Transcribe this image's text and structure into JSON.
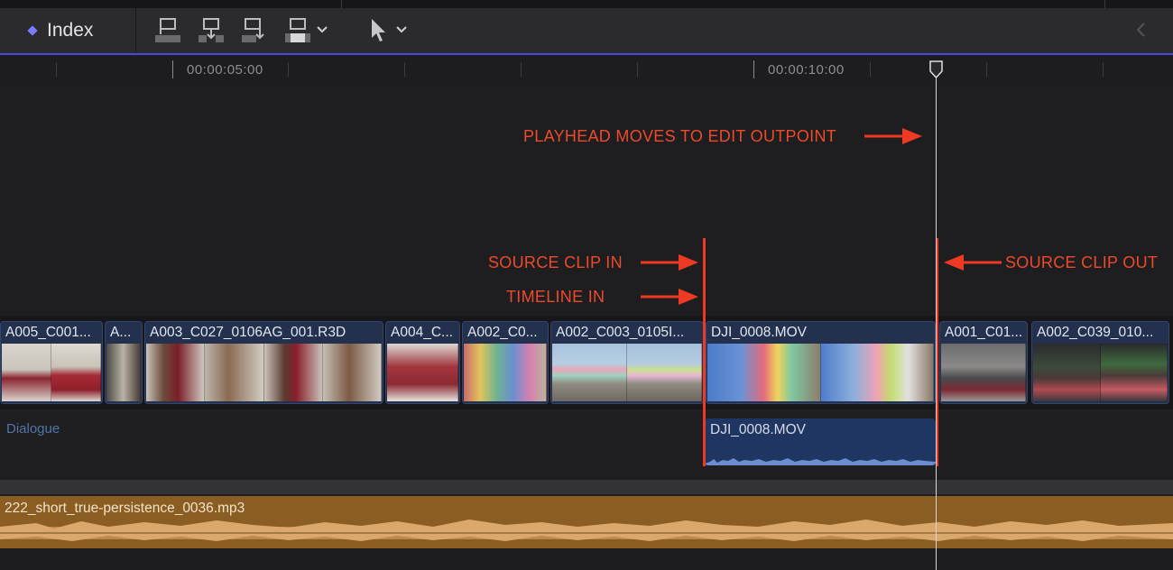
{
  "toolbar": {
    "index_label": "Index",
    "tools": [
      {
        "icon": "connect-clip-icon"
      },
      {
        "icon": "insert-clip-icon"
      },
      {
        "icon": "append-clip-icon"
      },
      {
        "icon": "overwrite-clip-icon"
      },
      {
        "icon": "select-tool-icon"
      }
    ]
  },
  "ruler": {
    "timecodes": [
      "00:00:05:00",
      "00:00:10:00"
    ]
  },
  "colors": {
    "annotation_red": "#ee3a22",
    "video_clip": "#23314f",
    "music_clip": "#8a5d23",
    "index_accent": "#7a7cff"
  },
  "timeline": {
    "video_clips": [
      {
        "name": "A005_C001..."
      },
      {
        "name": "A..."
      },
      {
        "name": "A003_C027_0106AG_001.R3D"
      },
      {
        "name": "A004_C..."
      },
      {
        "name": "A002_C0..."
      },
      {
        "name": "A002_C003_0105I..."
      },
      {
        "name": "DJI_0008.MOV"
      },
      {
        "name": "A001_C01..."
      },
      {
        "name": "A002_C039_010..."
      }
    ],
    "dialogue_role": "Dialogue",
    "audio_clip": "DJI_0008.MOV",
    "music_clip": "222_short_true-persistence_0036.mp3"
  },
  "annotations": {
    "playhead": "PLAYHEAD MOVES TO EDIT OUTPOINT",
    "source_in": "SOURCE CLIP IN",
    "timeline_in": "TIMELINE IN",
    "source_out": "SOURCE CLIP OUT"
  }
}
